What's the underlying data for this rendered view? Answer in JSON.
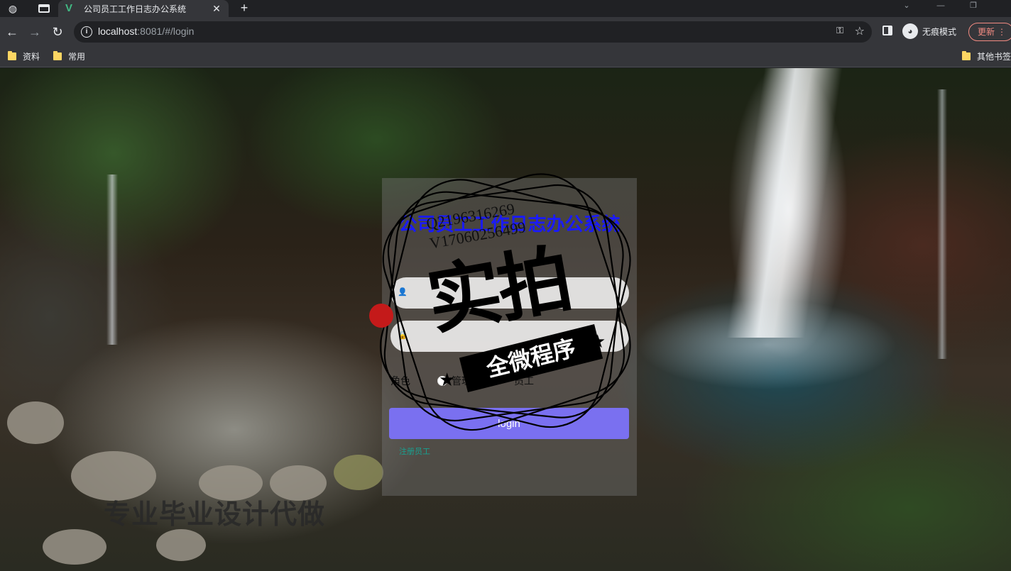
{
  "browser": {
    "tab_title": "公司员工工作日志办公系统",
    "url_host": "localhost",
    "url_rest": ":8081/#/login",
    "incognito_label": "无痕模式",
    "update_label": "更新",
    "bookmarks": [
      {
        "label": "资料"
      },
      {
        "label": "常用"
      }
    ],
    "other_bookmarks": "其他书签"
  },
  "login": {
    "title": "公司员工工作日志办公系统",
    "username_placeholder": "",
    "password_placeholder": "",
    "role_label": "角色",
    "role_options": [
      "管理员",
      "员工"
    ],
    "submit_label": "login",
    "register_link": "注册员工"
  },
  "watermark": {
    "contact_qq": "Q2196316269",
    "contact_v": "V17060256499",
    "big_text": "实拍",
    "banner_text": "全微程序",
    "bottom_text": "专业毕业设计代做"
  },
  "colors": {
    "title_blue": "#1a1aff",
    "button_purple": "#7a70f0",
    "link_teal": "#18a090"
  }
}
